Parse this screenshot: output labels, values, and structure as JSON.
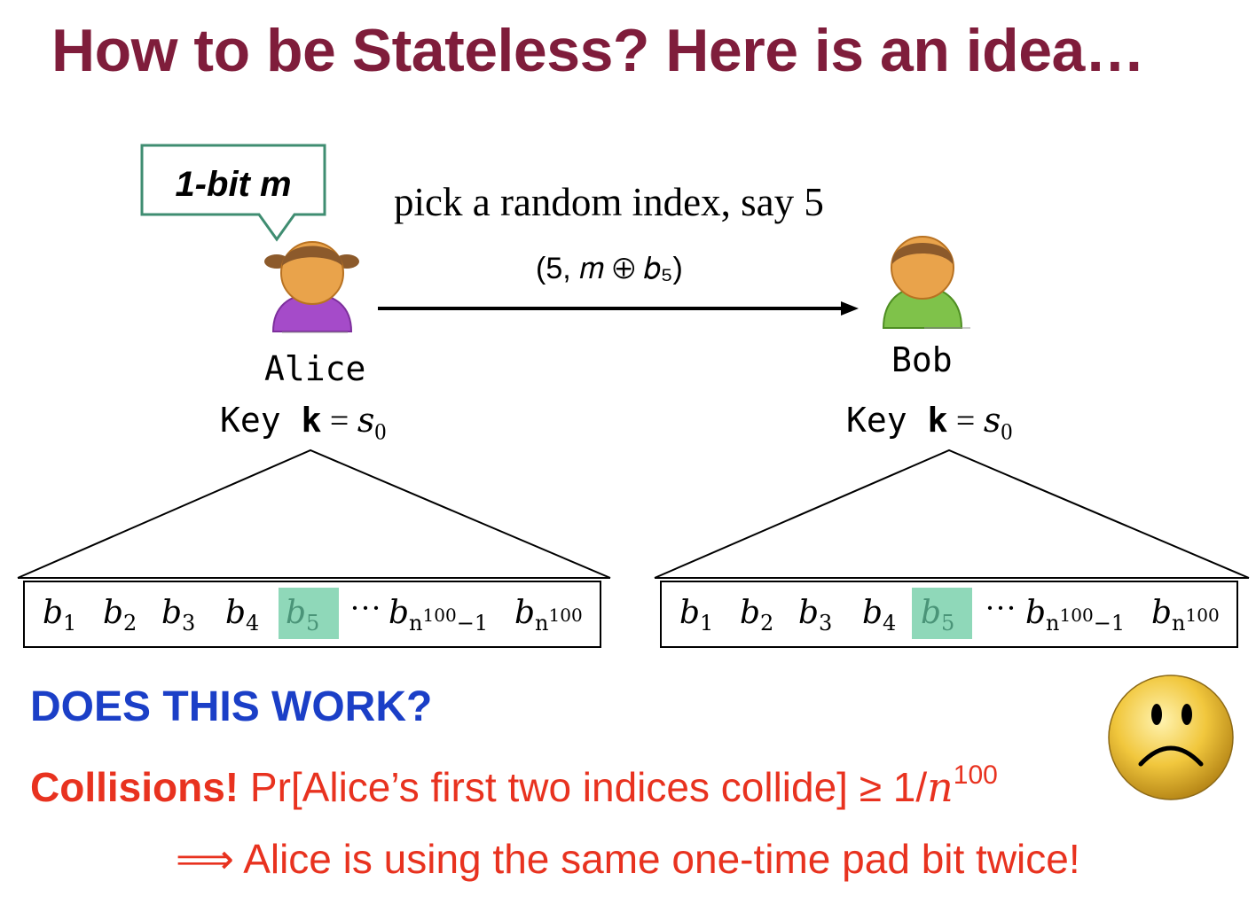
{
  "slide": {
    "title": "How to be Stateless? Here is an idea…",
    "speech_bubble": "1-bit m",
    "pick_text": "pick a random index, say 5",
    "message_label": "(5, 𝑚 ⊕ 𝑏₅)",
    "alice": {
      "name": "Alice",
      "key_prefix": "Key ",
      "key_k": "k",
      "key_eq": " = ",
      "key_s": "s",
      "key_sub": "0"
    },
    "bob": {
      "name": "Bob",
      "key_prefix": "Key ",
      "key_k": "k",
      "key_eq": " = ",
      "key_s": "s",
      "key_sub": "0"
    },
    "bits": {
      "b": "b",
      "subs": [
        "1",
        "2",
        "3",
        "4",
        "5"
      ],
      "ellipsis": "···",
      "n": "n",
      "exp": "100",
      "minus_one": "−1",
      "highlight_index": 5,
      "highlight_color": "#8fd8b9"
    },
    "question": "DOES THIS WORK?",
    "collision_bold": "Collisions!",
    "collision_rest": " Pr[Alice’s first two indices collide] ≥ 1/",
    "collision_n": "n",
    "collision_exp": "100",
    "implies": "⟹ Alice is using the same one-time pad bit twice!",
    "colors": {
      "title": "#7f1d3b",
      "question": "#1b3fc7",
      "warning": "#e8321f",
      "bubble_border": "#3f8d71",
      "alice_body": "#a54bc9",
      "bob_body": "#7fc24a",
      "face": "#e9a34b",
      "hair": "#8c5a2b"
    }
  }
}
